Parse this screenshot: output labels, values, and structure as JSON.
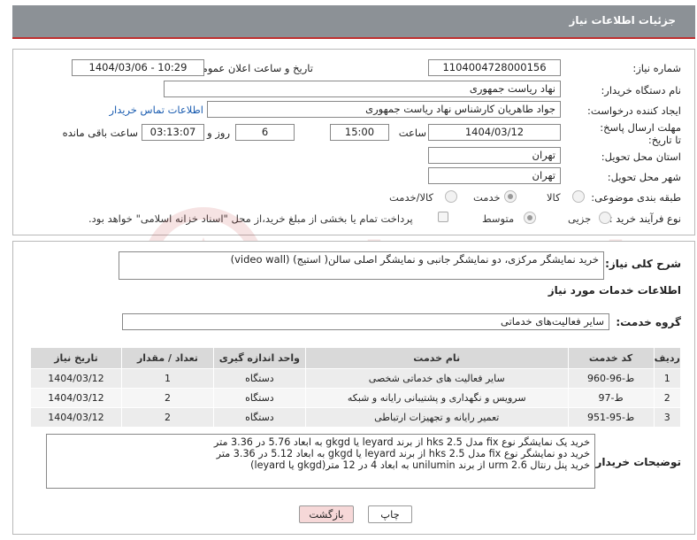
{
  "header": {
    "title": "جزئیات اطلاعات نیاز"
  },
  "fields": {
    "need_number_label": "شماره نیاز:",
    "need_number": "1104004728000156",
    "announce_label": "تاریخ و ساعت اعلان عمومی:",
    "announce_value": "1404/03/06 - 10:29",
    "buyer_org_label": "نام دستگاه خریدار:",
    "buyer_org": "نهاد ریاست جمهوری",
    "creator_label": "ایجاد کننده درخواست:",
    "creator": "جواد طاهریان کارشناس نهاد ریاست جمهوری",
    "contact_link": "اطلاعات تماس خریدار",
    "deadline_label": "مهلت ارسال پاسخ: تا تاریخ:",
    "deadline_date": "1404/03/12",
    "time_label": "ساعت",
    "deadline_time": "15:00",
    "days_value": "6",
    "days_label": "روز و",
    "remaining_time": "03:13:07",
    "remaining_label": "ساعت باقی مانده",
    "province_label": "استان محل تحویل:",
    "province": "تهران",
    "city_label": "شهر محل تحویل:",
    "city": "تهران",
    "category_label": "طبقه بندی موضوعی:",
    "category_options": [
      "کالا",
      "خدمت",
      "کالا/خدمت"
    ],
    "category_selected": "خدمت",
    "process_label": "نوع فرآیند خرید :",
    "process_options": [
      "جزیی",
      "متوسط"
    ],
    "process_selected": "متوسط",
    "payment_note": "پرداخت تمام یا بخشی از مبلغ خرید،از محل \"اسناد خزانه اسلامی\" خواهد بود."
  },
  "summary": {
    "label": "شرح کلی نیاز:",
    "text": "خرید نمایشگر مرکزی، دو نمایشگر جانبی و نمایشگر اصلی سالن( استیج) (video wall)"
  },
  "services": {
    "section_title": "اطلاعات خدمات مورد نیاز",
    "group_label": "گروه خدمت:",
    "group_value": "سایر فعالیت‌های خدماتی",
    "columns": [
      "ردیف",
      "کد خدمت",
      "نام خدمت",
      "واحد اندازه گیری",
      "تعداد / مقدار",
      "تاریخ نیاز"
    ],
    "rows": [
      [
        "1",
        "ط-96-960",
        "سایر فعالیت های خدماتی شخصی",
        "دستگاه",
        "1",
        "1404/03/12"
      ],
      [
        "2",
        "ط-97",
        "سرویس و نگهداری و پشتیبانی رایانه و شبکه",
        "دستگاه",
        "2",
        "1404/03/12"
      ],
      [
        "3",
        "ط-95-951",
        "تعمیر رایانه و تجهیزات ارتباطی",
        "دستگاه",
        "2",
        "1404/03/12"
      ]
    ]
  },
  "buyer_notes": {
    "label": "توضیحات خریدار:",
    "lines": [
      "خرید یک نمایشگر نوع fix مدل hks 2.5 از برند leyard یا gkgd  به ابعاد 5.76 در 3.36 متر",
      "خرید دو نمایشگر نوع fix مدل hks 2.5 از برند leyard یا gkgd  به ابعاد 5.12 در 3.36 متر",
      "خرید پنل رنتال urm 2.6 از برند unilumin به ابعاد 4 در 12 متر(gkgd یا leyard)"
    ]
  },
  "buttons": {
    "print": "چاپ",
    "back": "بازگشت"
  },
  "watermark": "AriaTender.neT",
  "colors": {
    "header_bg": "#8c9196",
    "header_border": "#c03030",
    "link": "#1a5cb0",
    "back_btn": "#f6d8d8",
    "print_btn": "#ffffff"
  }
}
